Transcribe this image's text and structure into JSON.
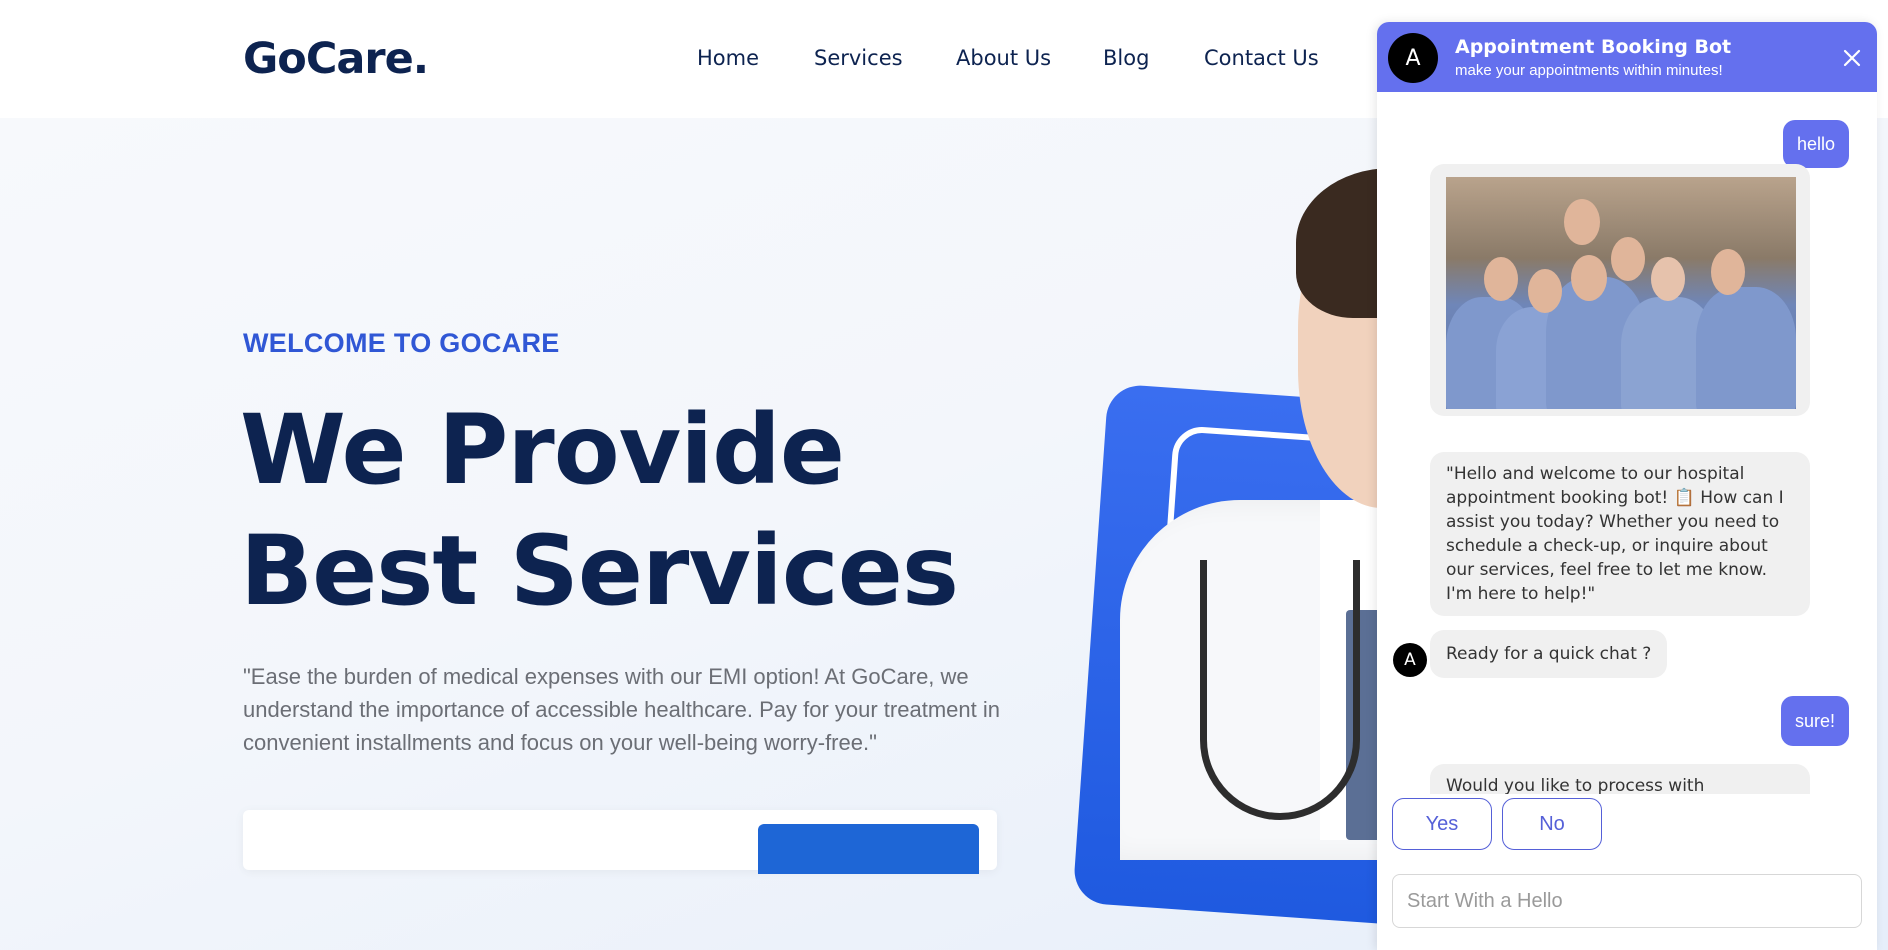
{
  "site": {
    "logo": "GoCare.",
    "nav": [
      "Home",
      "Services",
      "About Us",
      "Blog",
      "Contact Us"
    ]
  },
  "hero": {
    "kicker": "WELCOME TO GOCARE",
    "title_line1": "We Provide",
    "title_line2": "Best Services",
    "text": "\"Ease the burden of medical expenses with our EMI option! At GoCare, we understand the importance of accessible healthcare. Pay for your treatment in convenient installments and focus on your well-being worry-free.\""
  },
  "chat": {
    "avatar_letter": "A",
    "title": "Appointment Booking Bot",
    "subtitle": "make your appointments within minutes!",
    "close_icon": "close-icon",
    "messages": [
      {
        "from": "user",
        "text": "hello"
      },
      {
        "from": "bot",
        "type": "image",
        "alt": "team-photo"
      },
      {
        "from": "bot",
        "text": "\"Hello and welcome to our hospital appointment booking bot! 📋 How can I assist you today? Whether you need to schedule a check-up, or inquire about our services, feel free to let me know. I'm here to help!\""
      },
      {
        "from": "bot",
        "text": "Ready for a quick chat ?"
      },
      {
        "from": "user",
        "text": "sure!"
      },
      {
        "from": "bot",
        "text": "Would you like to process with"
      }
    ],
    "quick_replies": [
      "Yes",
      "No"
    ],
    "input_placeholder": "Start With a Hello"
  },
  "colors": {
    "brand_navy": "#0d2350",
    "accent_blue": "#3057d5",
    "chat_purple": "#6470ee"
  }
}
